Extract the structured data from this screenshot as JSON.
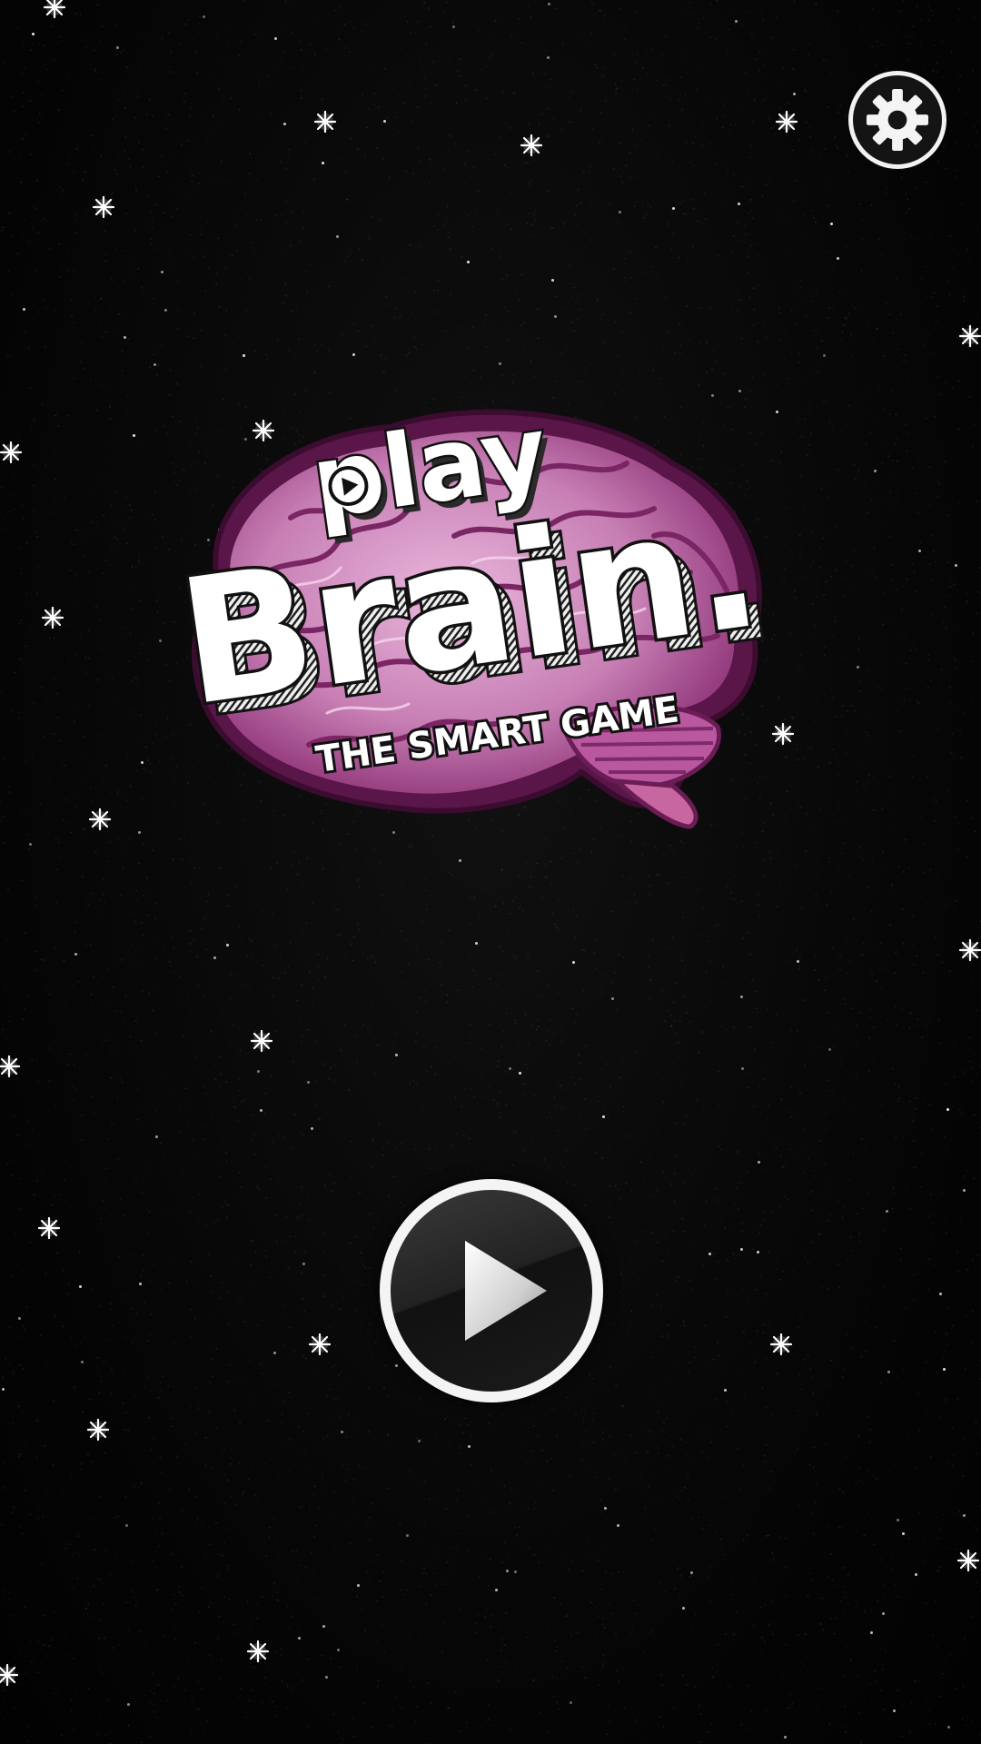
{
  "logo": {
    "line1": "play",
    "line2": "Brain.",
    "tagline": "THE SMART GAME"
  },
  "icons": {
    "settings": "gear-icon",
    "play": "play-triangle-icon",
    "logo_play": "small-play-circle-icon"
  },
  "colors": {
    "background": "#060606",
    "brain_dark": "#6a1d55",
    "brain_mid": "#b45a9c",
    "brain_light": "#e9b6dc",
    "button_ring": "#f4f4f4"
  }
}
